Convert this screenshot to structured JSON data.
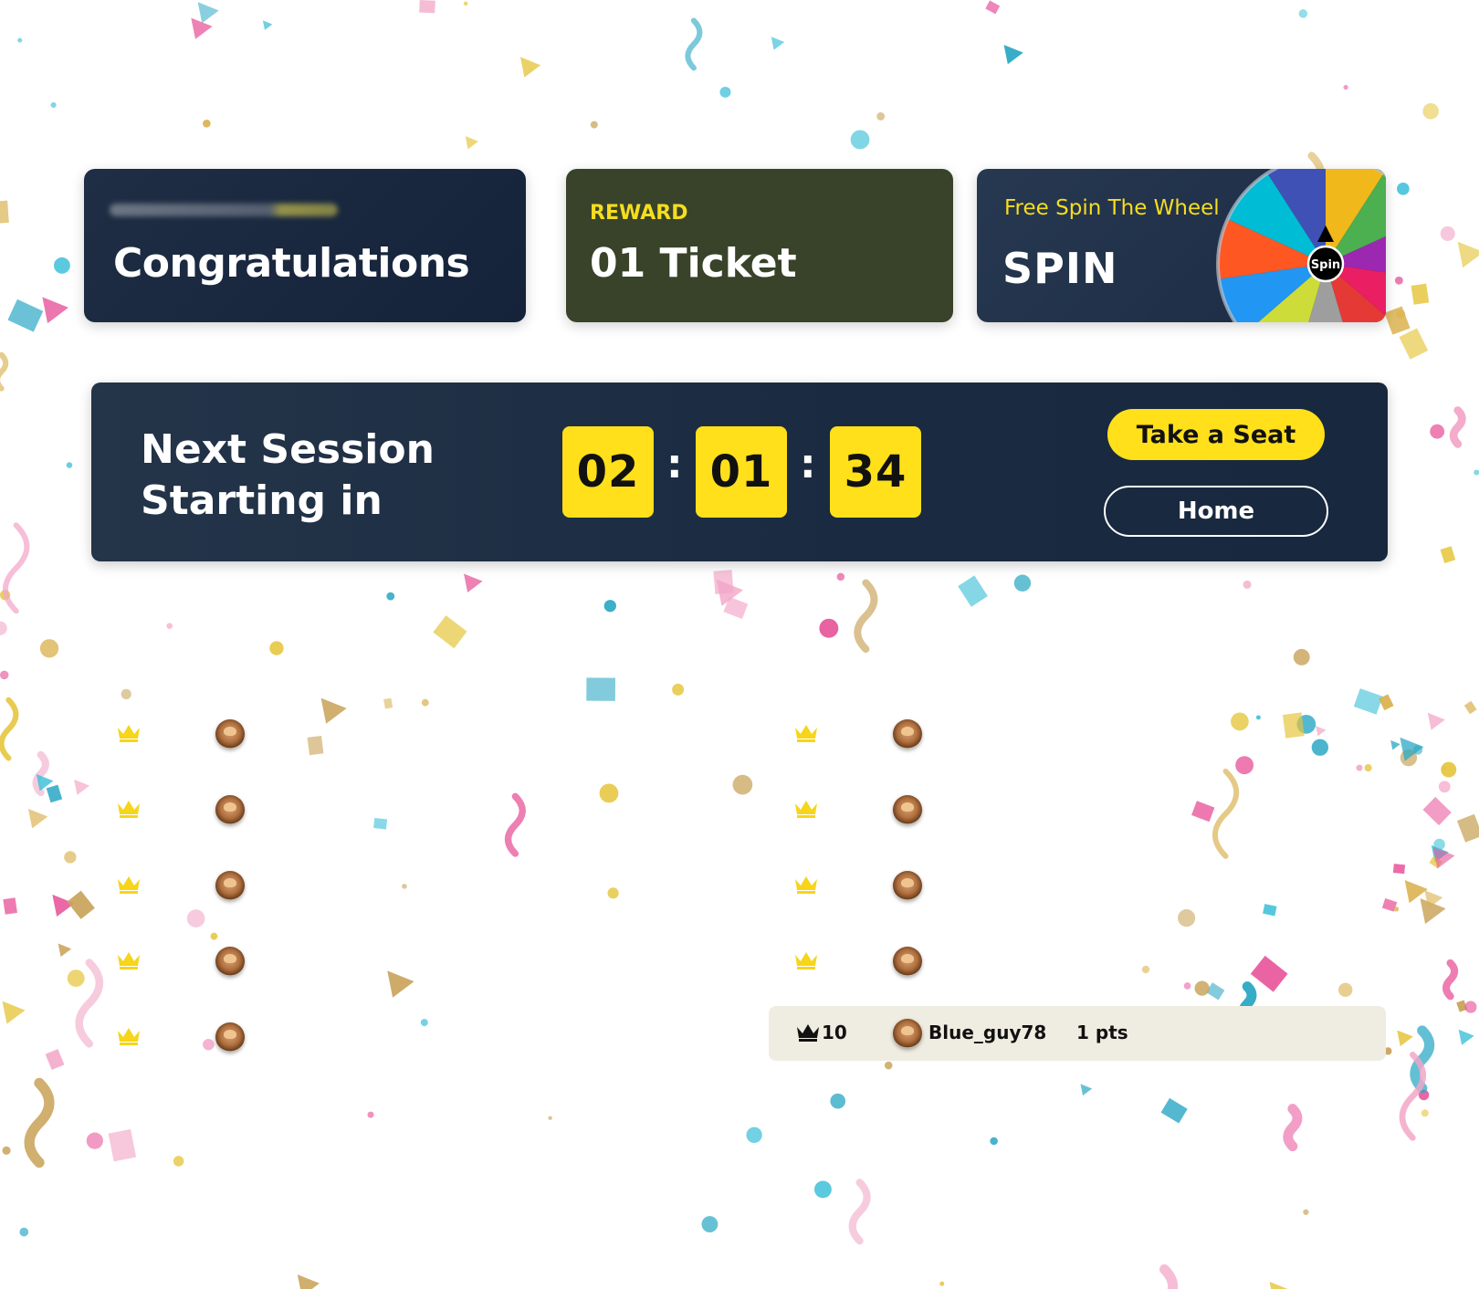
{
  "cards": {
    "congrats": {
      "title": "Congratulations"
    },
    "reward": {
      "label": "REWARD",
      "value": "01 Ticket"
    },
    "spin": {
      "subtitle": "Free Spin The Wheel",
      "title": "SPIN",
      "wheel_center_label": "Spin"
    }
  },
  "session": {
    "title_line1": "Next Session",
    "title_line2": "Starting in",
    "timer": {
      "hours": "02",
      "minutes": "01",
      "seconds": "34",
      "separator": ":"
    },
    "take_seat_label": "Take a Seat",
    "home_label": "Home"
  },
  "leaderboard": {
    "current_user": {
      "rank": "10",
      "username": "Blue_guy78",
      "points": "1 pts"
    }
  },
  "colors": {
    "accent_yellow": "#ffe01b",
    "card_dark": "#1a2a40",
    "reward_card": "#38432a",
    "crown_yellow": "#f6d51a",
    "highlight_row": "#efece1"
  },
  "wheel_colors": [
    "#f1b81b",
    "#4caf50",
    "#9c27b0",
    "#e91e63",
    "#e53935",
    "#9e9e9e",
    "#cddc39",
    "#2196f3",
    "#ff5722",
    "#00bcd4",
    "#3f51b5"
  ]
}
